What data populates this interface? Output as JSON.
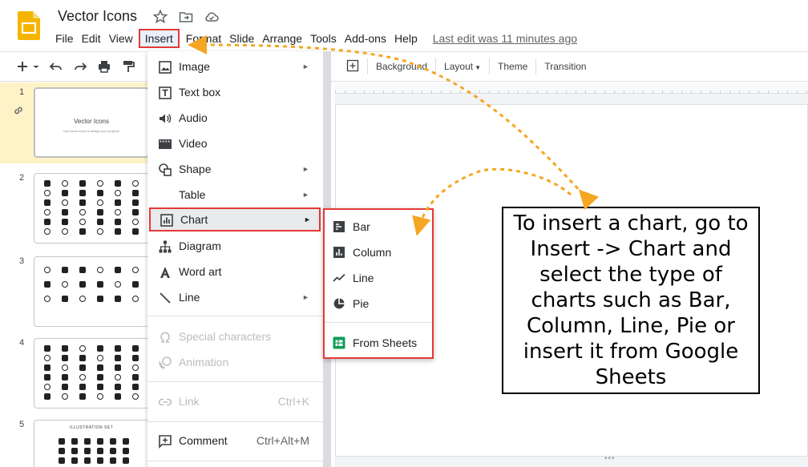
{
  "app": {
    "doc_title": "Vector Icons",
    "menu": [
      "File",
      "Edit",
      "View",
      "Insert",
      "Format",
      "Slide",
      "Arrange",
      "Tools",
      "Add-ons",
      "Help"
    ],
    "last_edit": "Last edit was 11 minutes ago",
    "icons": {
      "logo": "slides-logo-icon",
      "star": "star-icon",
      "move": "move-to-folder-icon",
      "cloud": "cloud-status-icon"
    }
  },
  "toolbar": {
    "left_icons": [
      "plus-icon",
      "dropdown-arrow-icon",
      "undo-icon",
      "redo-icon",
      "print-icon",
      "paint-format-icon"
    ],
    "background": "Background",
    "layout": "Layout",
    "theme": "Theme",
    "transition": "Transition"
  },
  "filmstrip": {
    "slides": [
      {
        "number": "1",
        "title": "Vector Icons",
        "subtitle": "Use these icons to design your projects"
      },
      {
        "number": "2"
      },
      {
        "number": "3"
      },
      {
        "number": "4"
      },
      {
        "number": "5",
        "title": "ILLUSTRATION SET"
      }
    ]
  },
  "insert_menu": {
    "items": [
      {
        "label": "Image",
        "icon": "image-icon",
        "submenu": true
      },
      {
        "label": "Text box",
        "icon": "text-box-icon"
      },
      {
        "label": "Audio",
        "icon": "audio-icon"
      },
      {
        "label": "Video",
        "icon": "video-icon"
      },
      {
        "label": "Shape",
        "icon": "shape-icon",
        "submenu": true
      },
      {
        "label": "Table",
        "submenu": true
      },
      {
        "label": "Chart",
        "icon": "chart-icon",
        "submenu": true,
        "highlighted": true
      },
      {
        "label": "Diagram",
        "icon": "diagram-icon"
      },
      {
        "label": "Word art",
        "icon": "word-art-icon"
      },
      {
        "label": "Line",
        "icon": "line-icon",
        "submenu": true
      },
      {
        "label": "Special characters",
        "icon": "omega-icon",
        "disabled": true
      },
      {
        "label": "Animation",
        "icon": "animation-icon",
        "disabled": true
      },
      {
        "label": "Link",
        "icon": "link-icon",
        "shortcut": "Ctrl+K",
        "disabled": true
      },
      {
        "label": "Comment",
        "icon": "comment-icon",
        "shortcut": "Ctrl+Alt+M"
      }
    ],
    "submenu_arrow": "►"
  },
  "chart_submenu": {
    "items": [
      {
        "label": "Bar",
        "icon": "bar-chart-icon"
      },
      {
        "label": "Column",
        "icon": "column-chart-icon"
      },
      {
        "label": "Line",
        "icon": "line-chart-icon"
      },
      {
        "label": "Pie",
        "icon": "pie-chart-icon"
      },
      {
        "label": "From Sheets",
        "icon": "sheets-icon"
      }
    ]
  },
  "callout": {
    "text": "To insert a chart, go to Insert -> Chart and select the type of charts such as Bar, Column, Line, Pie or insert it from Google Sheets"
  },
  "colors": {
    "highlight_border": "#e53935",
    "arrow": "#f5a623",
    "slides_yellow": "#f4b400",
    "sheets_green": "#0f9d58",
    "selected_slide_bg": "#fef3c7"
  }
}
